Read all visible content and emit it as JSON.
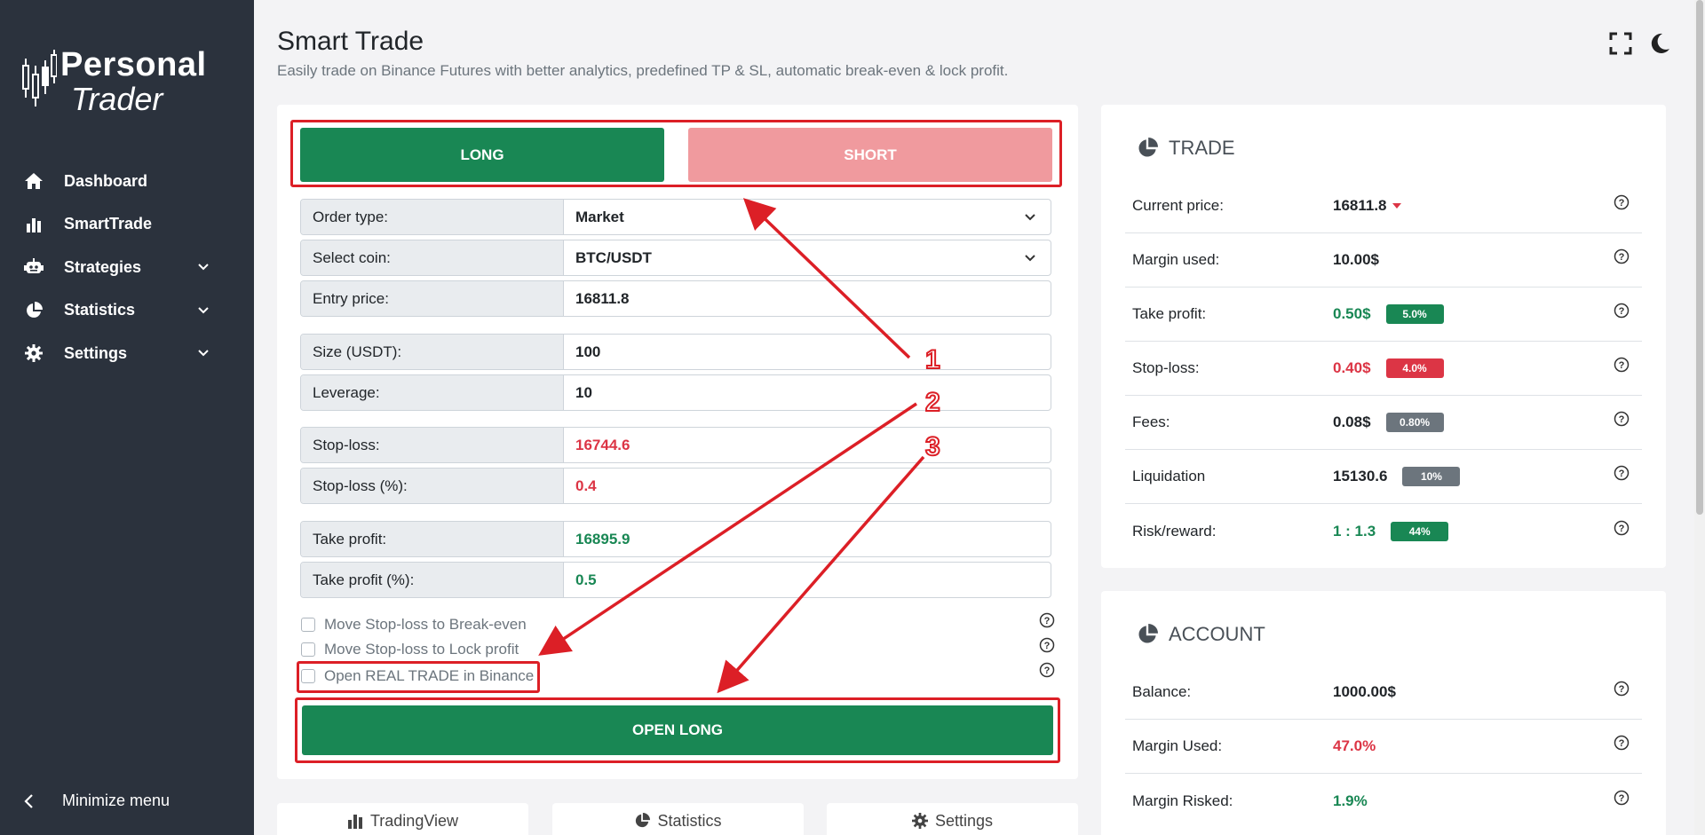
{
  "sidebar": {
    "brand_line1": "Personal",
    "brand_line2": "Trader",
    "items": [
      {
        "label": "Dashboard",
        "icon": "home-icon"
      },
      {
        "label": "SmartTrade",
        "icon": "bar-chart-icon"
      },
      {
        "label": "Strategies",
        "icon": "robot-icon"
      },
      {
        "label": "Statistics",
        "icon": "pie-chart-icon"
      },
      {
        "label": "Settings",
        "icon": "gear-icon"
      }
    ],
    "minimize_label": "Minimize menu"
  },
  "header": {
    "title": "Smart Trade",
    "subtitle": "Easily trade on Binance Futures with better analytics, predefined TP & SL, automatic break-even & lock profit."
  },
  "form": {
    "long_label": "LONG",
    "short_label": "SHORT",
    "fields": [
      {
        "label": "Order type:",
        "value": "Market"
      },
      {
        "label": "Select coin:",
        "value": "BTC/USDT"
      },
      {
        "label": "Entry price:",
        "value": "16811.8"
      },
      {
        "label": "Size (USDT):",
        "value": "100"
      },
      {
        "label": "Leverage:",
        "value": "10"
      },
      {
        "label": "Stop-loss:",
        "value": "16744.6"
      },
      {
        "label": "Stop-loss (%):",
        "value": "0.4"
      },
      {
        "label": "Take profit:",
        "value": "16895.9"
      },
      {
        "label": "Take profit (%):",
        "value": "0.5"
      }
    ],
    "checkboxes": [
      {
        "label": "Move Stop-loss to Break-even",
        "checked": false
      },
      {
        "label": "Move Stop-loss to Lock profit",
        "checked": false
      },
      {
        "label": "Open REAL TRADE in Binance",
        "checked": false
      }
    ],
    "open_label": "OPEN LONG"
  },
  "tabs": [
    {
      "label": "TradingView",
      "icon": "bar-chart-icon"
    },
    {
      "label": "Statistics",
      "icon": "pie-chart-icon"
    },
    {
      "label": "Settings",
      "icon": "gear-icon"
    }
  ],
  "trade": {
    "heading": "TRADE",
    "rows": [
      {
        "label": "Current price:",
        "value": "16811.8",
        "badge": ""
      },
      {
        "label": "Margin used:",
        "value": "10.00$",
        "badge": ""
      },
      {
        "label": "Take profit:",
        "value": "0.50$",
        "badge": "5.0%"
      },
      {
        "label": "Stop-loss:",
        "value": "0.40$",
        "badge": "4.0%"
      },
      {
        "label": "Fees:",
        "value": "0.08$",
        "badge": "0.80%"
      },
      {
        "label": "Liquidation",
        "value": "15130.6",
        "badge": "10%"
      },
      {
        "label": "Risk/reward:",
        "value": "1 : 1.3",
        "badge": "44%"
      }
    ]
  },
  "account": {
    "heading": "ACCOUNT",
    "rows": [
      {
        "label": "Balance:",
        "value": "1000.00$"
      },
      {
        "label": "Margin Used:",
        "value": "47.0%"
      },
      {
        "label": "Margin Risked:",
        "value": "1.9%"
      }
    ]
  },
  "annotations": [
    "1",
    "2",
    "3"
  ],
  "colors": {
    "sidebar_bg": "#2b323d",
    "long_green": "#198754",
    "short_pink": "#f09a9e",
    "danger_red": "#dc3545",
    "annotation_red": "#dc1f26",
    "muted_gray": "#6c757d"
  }
}
